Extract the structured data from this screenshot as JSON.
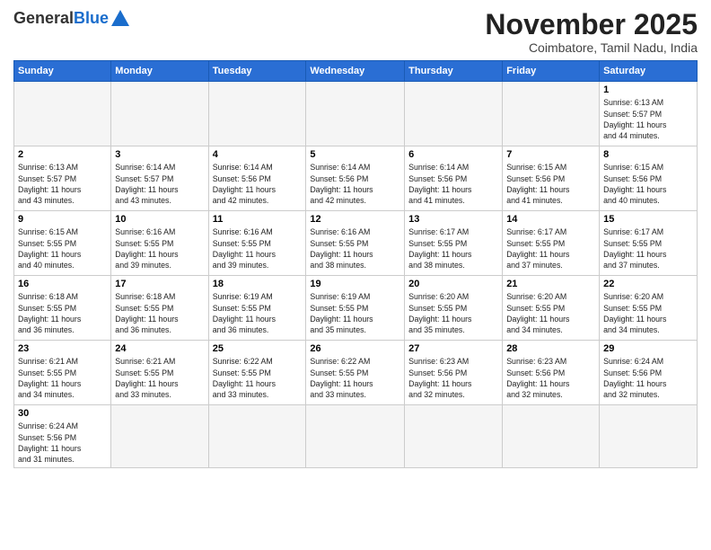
{
  "header": {
    "logo_general": "General",
    "logo_blue": "Blue",
    "month_title": "November 2025",
    "location": "Coimbatore, Tamil Nadu, India"
  },
  "weekdays": [
    "Sunday",
    "Monday",
    "Tuesday",
    "Wednesday",
    "Thursday",
    "Friday",
    "Saturday"
  ],
  "days": [
    {
      "num": "",
      "info": ""
    },
    {
      "num": "",
      "info": ""
    },
    {
      "num": "",
      "info": ""
    },
    {
      "num": "",
      "info": ""
    },
    {
      "num": "",
      "info": ""
    },
    {
      "num": "",
      "info": ""
    },
    {
      "num": "1",
      "info": "Sunrise: 6:13 AM\nSunset: 5:57 PM\nDaylight: 11 hours\nand 44 minutes."
    },
    {
      "num": "2",
      "info": "Sunrise: 6:13 AM\nSunset: 5:57 PM\nDaylight: 11 hours\nand 43 minutes."
    },
    {
      "num": "3",
      "info": "Sunrise: 6:14 AM\nSunset: 5:57 PM\nDaylight: 11 hours\nand 43 minutes."
    },
    {
      "num": "4",
      "info": "Sunrise: 6:14 AM\nSunset: 5:56 PM\nDaylight: 11 hours\nand 42 minutes."
    },
    {
      "num": "5",
      "info": "Sunrise: 6:14 AM\nSunset: 5:56 PM\nDaylight: 11 hours\nand 42 minutes."
    },
    {
      "num": "6",
      "info": "Sunrise: 6:14 AM\nSunset: 5:56 PM\nDaylight: 11 hours\nand 41 minutes."
    },
    {
      "num": "7",
      "info": "Sunrise: 6:15 AM\nSunset: 5:56 PM\nDaylight: 11 hours\nand 41 minutes."
    },
    {
      "num": "8",
      "info": "Sunrise: 6:15 AM\nSunset: 5:56 PM\nDaylight: 11 hours\nand 40 minutes."
    },
    {
      "num": "9",
      "info": "Sunrise: 6:15 AM\nSunset: 5:55 PM\nDaylight: 11 hours\nand 40 minutes."
    },
    {
      "num": "10",
      "info": "Sunrise: 6:16 AM\nSunset: 5:55 PM\nDaylight: 11 hours\nand 39 minutes."
    },
    {
      "num": "11",
      "info": "Sunrise: 6:16 AM\nSunset: 5:55 PM\nDaylight: 11 hours\nand 39 minutes."
    },
    {
      "num": "12",
      "info": "Sunrise: 6:16 AM\nSunset: 5:55 PM\nDaylight: 11 hours\nand 38 minutes."
    },
    {
      "num": "13",
      "info": "Sunrise: 6:17 AM\nSunset: 5:55 PM\nDaylight: 11 hours\nand 38 minutes."
    },
    {
      "num": "14",
      "info": "Sunrise: 6:17 AM\nSunset: 5:55 PM\nDaylight: 11 hours\nand 37 minutes."
    },
    {
      "num": "15",
      "info": "Sunrise: 6:17 AM\nSunset: 5:55 PM\nDaylight: 11 hours\nand 37 minutes."
    },
    {
      "num": "16",
      "info": "Sunrise: 6:18 AM\nSunset: 5:55 PM\nDaylight: 11 hours\nand 36 minutes."
    },
    {
      "num": "17",
      "info": "Sunrise: 6:18 AM\nSunset: 5:55 PM\nDaylight: 11 hours\nand 36 minutes."
    },
    {
      "num": "18",
      "info": "Sunrise: 6:19 AM\nSunset: 5:55 PM\nDaylight: 11 hours\nand 36 minutes."
    },
    {
      "num": "19",
      "info": "Sunrise: 6:19 AM\nSunset: 5:55 PM\nDaylight: 11 hours\nand 35 minutes."
    },
    {
      "num": "20",
      "info": "Sunrise: 6:20 AM\nSunset: 5:55 PM\nDaylight: 11 hours\nand 35 minutes."
    },
    {
      "num": "21",
      "info": "Sunrise: 6:20 AM\nSunset: 5:55 PM\nDaylight: 11 hours\nand 34 minutes."
    },
    {
      "num": "22",
      "info": "Sunrise: 6:20 AM\nSunset: 5:55 PM\nDaylight: 11 hours\nand 34 minutes."
    },
    {
      "num": "23",
      "info": "Sunrise: 6:21 AM\nSunset: 5:55 PM\nDaylight: 11 hours\nand 34 minutes."
    },
    {
      "num": "24",
      "info": "Sunrise: 6:21 AM\nSunset: 5:55 PM\nDaylight: 11 hours\nand 33 minutes."
    },
    {
      "num": "25",
      "info": "Sunrise: 6:22 AM\nSunset: 5:55 PM\nDaylight: 11 hours\nand 33 minutes."
    },
    {
      "num": "26",
      "info": "Sunrise: 6:22 AM\nSunset: 5:55 PM\nDaylight: 11 hours\nand 33 minutes."
    },
    {
      "num": "27",
      "info": "Sunrise: 6:23 AM\nSunset: 5:56 PM\nDaylight: 11 hours\nand 32 minutes."
    },
    {
      "num": "28",
      "info": "Sunrise: 6:23 AM\nSunset: 5:56 PM\nDaylight: 11 hours\nand 32 minutes."
    },
    {
      "num": "29",
      "info": "Sunrise: 6:24 AM\nSunset: 5:56 PM\nDaylight: 11 hours\nand 32 minutes."
    },
    {
      "num": "30",
      "info": "Sunrise: 6:24 AM\nSunset: 5:56 PM\nDaylight: 11 hours\nand 31 minutes."
    },
    {
      "num": "",
      "info": ""
    },
    {
      "num": "",
      "info": ""
    },
    {
      "num": "",
      "info": ""
    },
    {
      "num": "",
      "info": ""
    },
    {
      "num": "",
      "info": ""
    },
    {
      "num": "",
      "info": ""
    }
  ]
}
